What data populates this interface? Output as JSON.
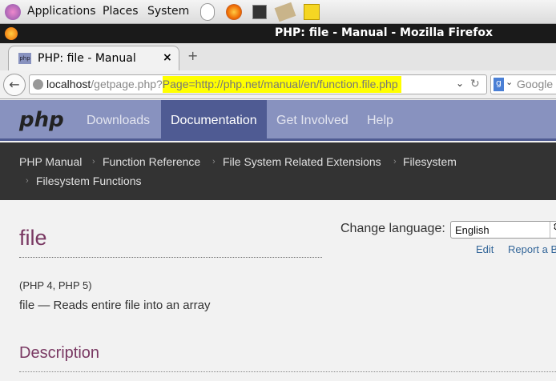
{
  "panel": {
    "items": [
      "Applications",
      "Places",
      "System"
    ],
    "launchers": [
      "mouse-icon",
      "firefox-icon",
      "terminal-icon",
      "package-icon",
      "notes-icon"
    ]
  },
  "window": {
    "title": "PHP: file - Manual - Mozilla Firefox"
  },
  "tab": {
    "label": "PHP: file - Manual",
    "favicon": "php"
  },
  "url": {
    "host": "localhost",
    "path": "/getpage.php?",
    "query": "Page=http://php.net/manual/en/function.file.php",
    "highlight": "#ffff00"
  },
  "search": {
    "placeholder": "Google"
  },
  "phpnav": {
    "logo": "php",
    "items": [
      "Downloads",
      "Documentation",
      "Get Involved",
      "Help"
    ],
    "active": "Documentation"
  },
  "breadcrumb": [
    "PHP Manual",
    "Function Reference",
    "File System Related Extensions",
    "Filesystem",
    "Filesystem Functions"
  ],
  "page": {
    "title": "file",
    "versions": "(PHP 4, PHP 5)",
    "summary": "file — Reads entire file into an array",
    "section": "Description"
  },
  "lang": {
    "label": "Change language:",
    "selected": "English",
    "edit": "Edit",
    "report": "Report a Bug"
  }
}
